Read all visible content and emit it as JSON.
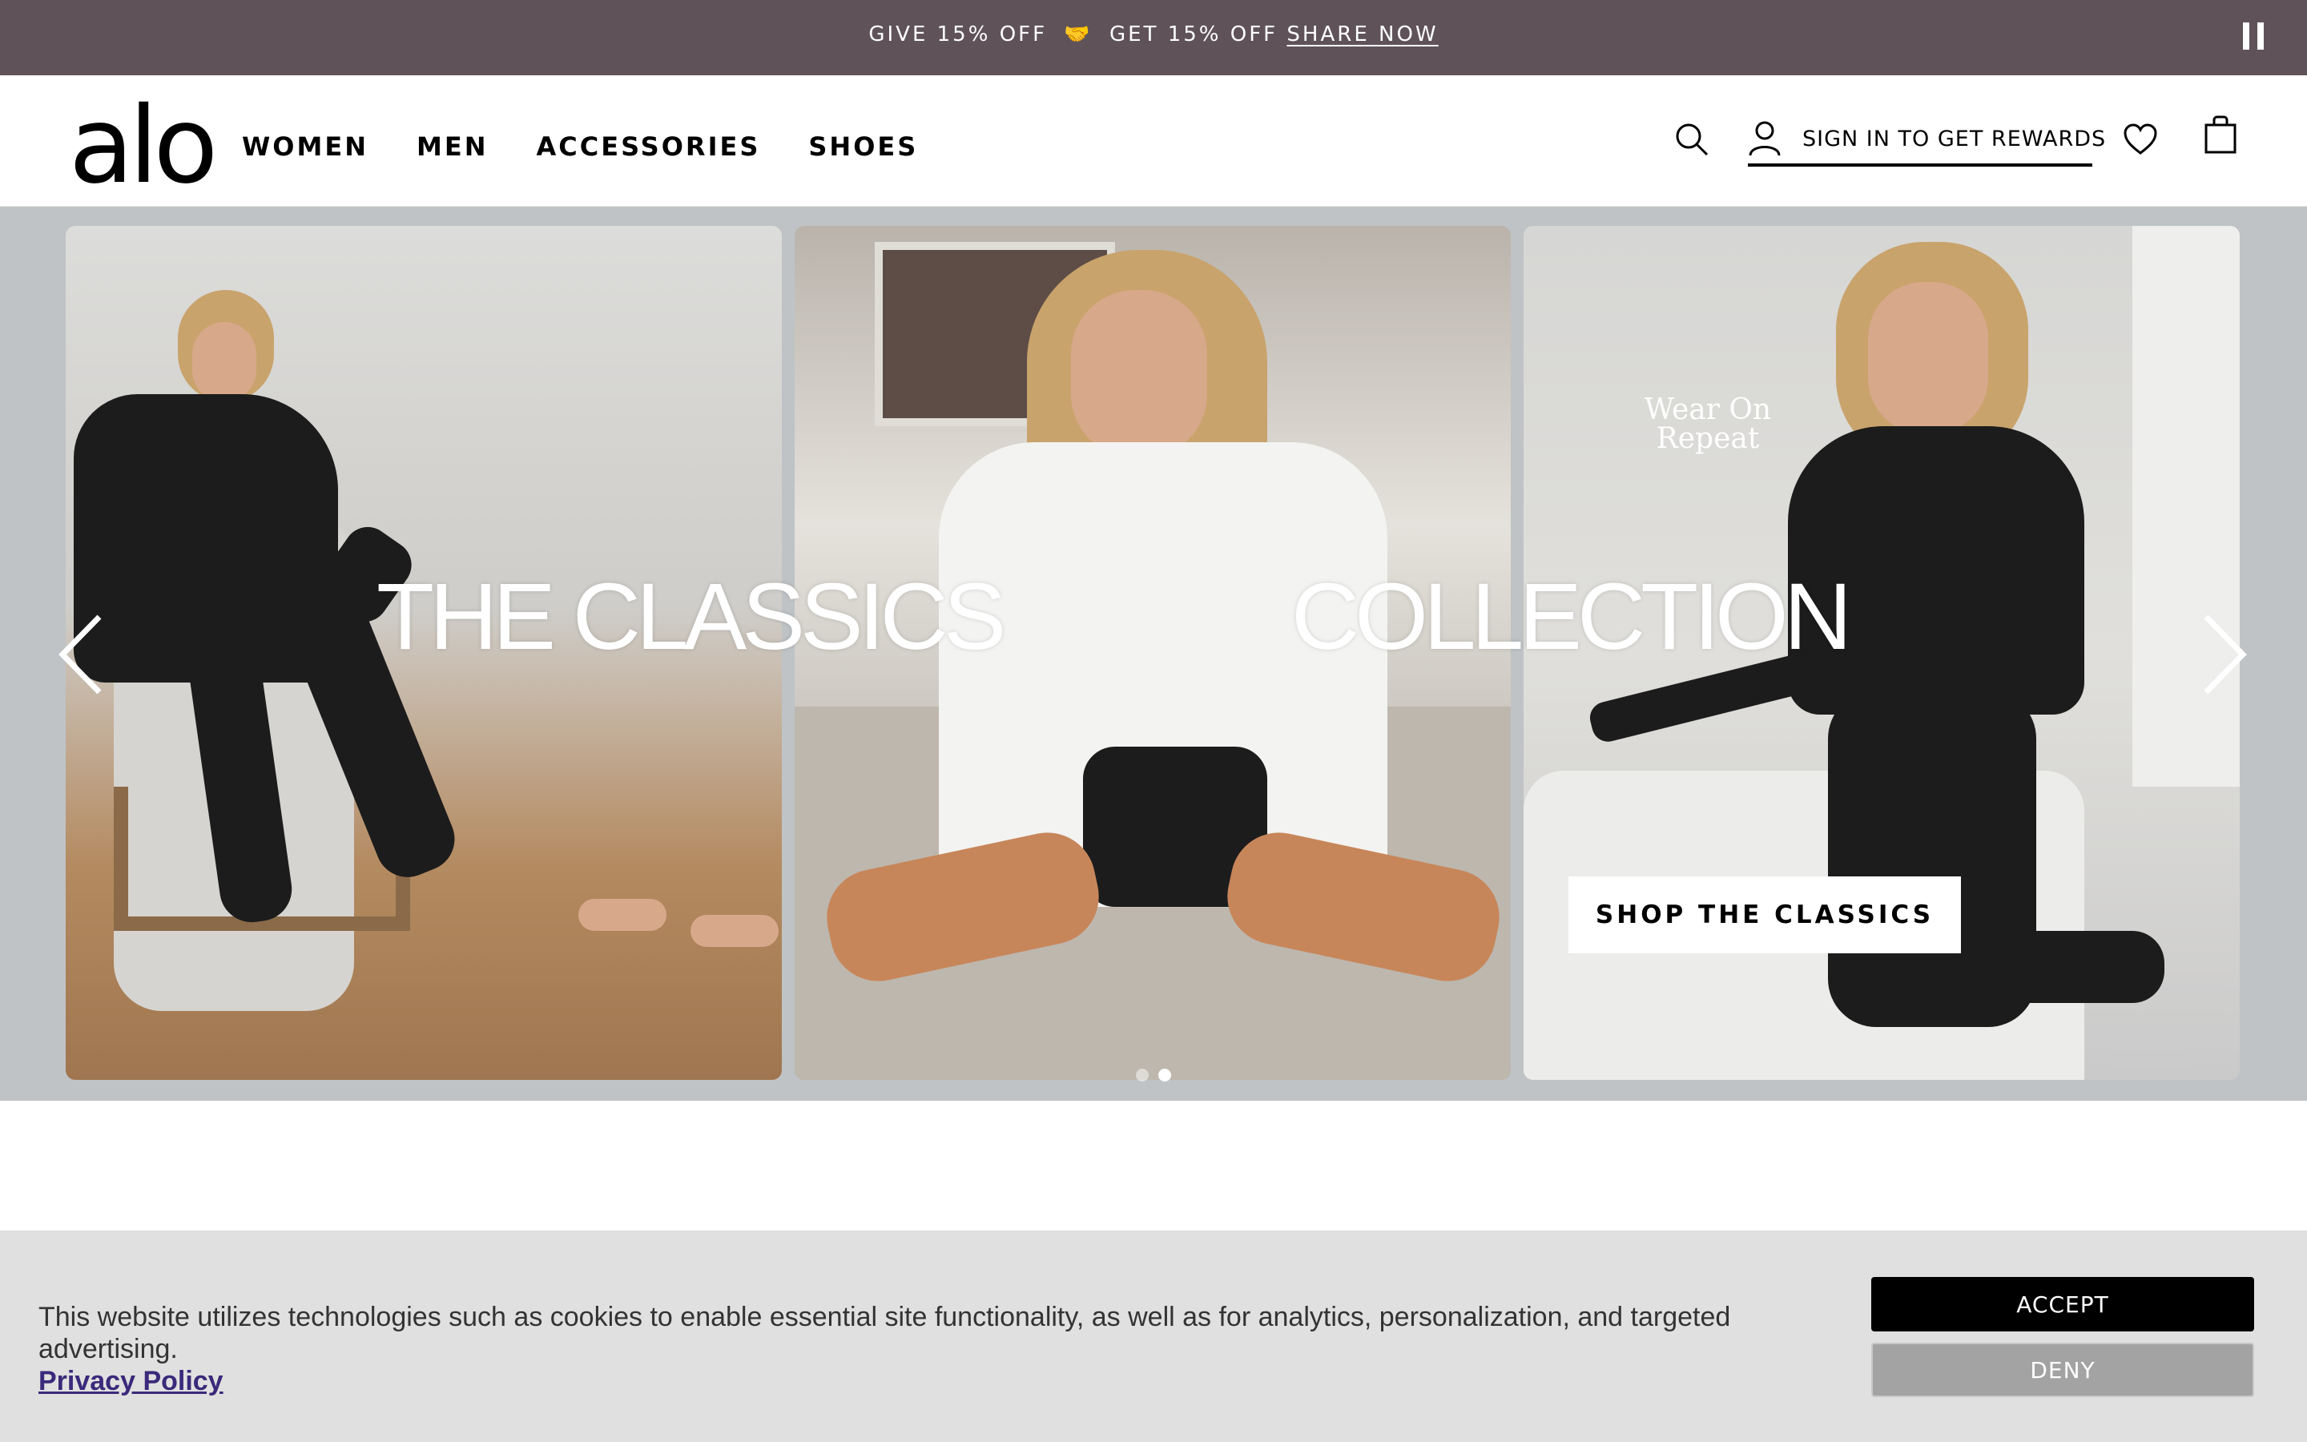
{
  "promo": {
    "give_text": "GIVE 15% OFF",
    "handshake": "🤝",
    "get_text": "GET 15% OFF",
    "share_link": "SHARE NOW"
  },
  "header": {
    "logo": "alo",
    "nav": [
      "WOMEN",
      "MEN",
      "ACCESSORIES",
      "SHOES"
    ],
    "signin_label": "SIGN IN TO GET REWARDS"
  },
  "hero": {
    "title_left": "THE CLASSICS",
    "title_right": "COLLECTION",
    "tagline": "Wear On Repeat",
    "cta": "SHOP THE CLASSICS",
    "slides_total": 2,
    "active_slide": 2
  },
  "cookie": {
    "message": "This website utilizes technologies such as cookies to enable essential site functionality, as well as for analytics, personalization, and targeted advertising.",
    "privacy_link": "Privacy Policy",
    "accept": "ACCEPT",
    "deny": "DENY"
  },
  "colors": {
    "promo_bg": "#5f5359",
    "cookie_bg": "#e0e0e0",
    "accept_bg": "#000000",
    "deny_bg": "#a3a3a3"
  }
}
